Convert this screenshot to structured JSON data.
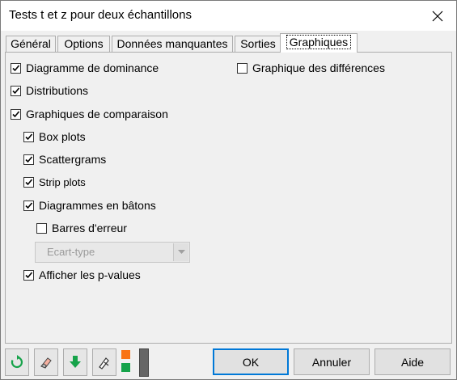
{
  "window": {
    "title": "Tests t et z pour deux échantillons"
  },
  "tabs": [
    {
      "label": "Général"
    },
    {
      "label": "Options"
    },
    {
      "label": "Données manquantes"
    },
    {
      "label": "Sorties"
    },
    {
      "label": "Graphiques"
    }
  ],
  "active_tab": "Graphiques",
  "options": {
    "dominance": {
      "label": "Diagramme de dominance",
      "checked": true
    },
    "distributions": {
      "label": "Distributions",
      "checked": true
    },
    "comparison": {
      "label": "Graphiques de comparaison",
      "checked": true
    },
    "boxplots": {
      "label": "Box plots",
      "checked": true
    },
    "scattergrams": {
      "label": "Scattergrams",
      "checked": true
    },
    "strip": {
      "label": "Strip plots",
      "checked": true
    },
    "bars": {
      "label": "Diagrammes en bâtons",
      "checked": true
    },
    "errorbars": {
      "label": "Barres d'erreur",
      "checked": false
    },
    "pvalues": {
      "label": "Afficher les p-values",
      "checked": true
    },
    "differences": {
      "label": "Graphique des différences",
      "checked": false
    }
  },
  "error_type": {
    "value": "Ecart-type"
  },
  "buttons": {
    "ok": "OK",
    "cancel": "Annuler",
    "help": "Aide"
  },
  "icons": [
    "reset-icon",
    "eraser-icon",
    "download-icon",
    "cursor-icon",
    "layout-toggle-icon"
  ],
  "colors": {
    "accent": "#0078d7",
    "icon_green": "#16a34a",
    "icon_orange": "#f97316"
  }
}
